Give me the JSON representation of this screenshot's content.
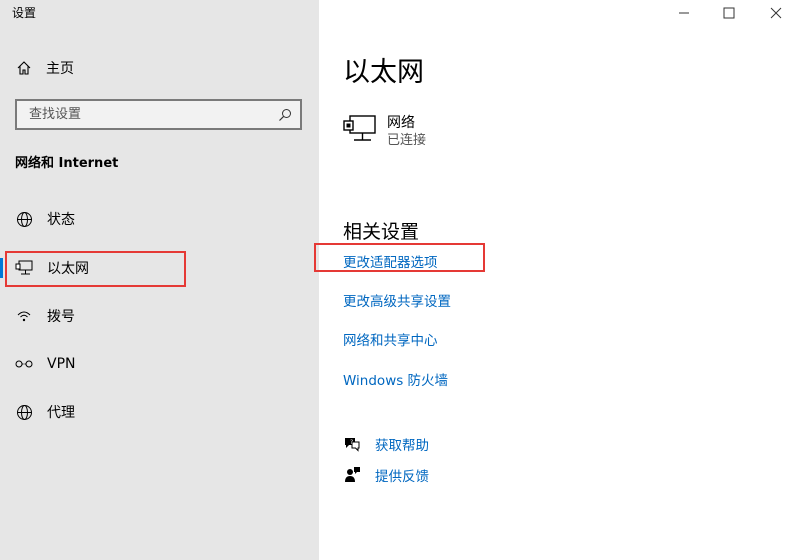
{
  "window": {
    "title": "设置",
    "controls": {
      "minimize": "—",
      "maximize": "☐",
      "close": "✕"
    }
  },
  "sidebar": {
    "home_label": "主页",
    "search_placeholder": "查找设置",
    "section_title": "网络和 Internet",
    "items": [
      {
        "label": "状态",
        "icon": "status-globe-icon"
      },
      {
        "label": "以太网",
        "icon": "ethernet-icon",
        "selected": true
      },
      {
        "label": "拨号",
        "icon": "dialup-icon"
      },
      {
        "label": "VPN",
        "icon": "vpn-icon"
      },
      {
        "label": "代理",
        "icon": "proxy-globe-icon"
      }
    ]
  },
  "main": {
    "title": "以太网",
    "network": {
      "name": "网络",
      "status": "已连接"
    },
    "related_title": "相关设置",
    "links": [
      "更改适配器选项",
      "更改高级共享设置",
      "网络和共享中心",
      "Windows 防火墙"
    ],
    "help": [
      {
        "label": "获取帮助",
        "icon": "help-chat-icon"
      },
      {
        "label": "提供反馈",
        "icon": "feedback-icon"
      }
    ]
  },
  "colors": {
    "accent": "#0078d7",
    "link": "#0067c0",
    "highlight": "#e53935",
    "sidebar_bg": "#e6e6e6"
  }
}
